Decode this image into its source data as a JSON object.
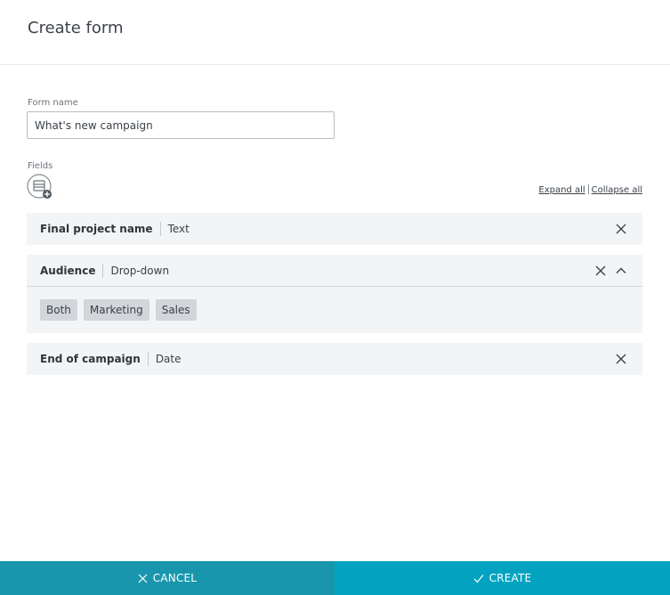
{
  "header": {
    "title": "Create form"
  },
  "form": {
    "name_label": "Form name",
    "name_value": "What's new campaign",
    "fields_label": "Fields",
    "add_field_icon": "add-field-icon",
    "expand_all": "Expand all",
    "collapse_all": "Collapse all"
  },
  "fields": [
    {
      "name": "Final project name",
      "type": "Text"
    },
    {
      "name": "Audience",
      "type": "Drop-down",
      "options": [
        "Both",
        "Marketing",
        "Sales"
      ]
    },
    {
      "name": "End of campaign",
      "type": "Date"
    }
  ],
  "footer": {
    "cancel_label": "CANCEL",
    "create_label": "CREATE"
  },
  "colors": {
    "cancel_bg": "#1996ad",
    "create_bg": "#02a3c1",
    "card_bg": "#f3f4f5",
    "chip_bg": "#d2d6da"
  }
}
